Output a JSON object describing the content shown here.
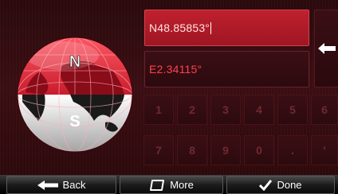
{
  "globe": {
    "north_label": "N",
    "south_label": "S",
    "active_hemisphere": "north"
  },
  "fields": {
    "latitude": {
      "value": "N48.85853°"
    },
    "longitude": {
      "value": "E2.34115°"
    }
  },
  "keypad": {
    "row1": [
      "1",
      "2",
      "3",
      "4",
      "5",
      "6"
    ],
    "row2": [
      "7",
      "8",
      "9",
      "0",
      ".",
      "'"
    ]
  },
  "buttons": {
    "back_label": "Back",
    "more_label": "More",
    "done_label": "Done"
  },
  "icons": {
    "back": "left-arrow-icon",
    "more": "rounded-square-icon",
    "done": "checkmark-icon",
    "backspace": "left-arrow-icon"
  },
  "colors": {
    "accent": "#c0202e",
    "inactive_text": "#ff4050"
  }
}
